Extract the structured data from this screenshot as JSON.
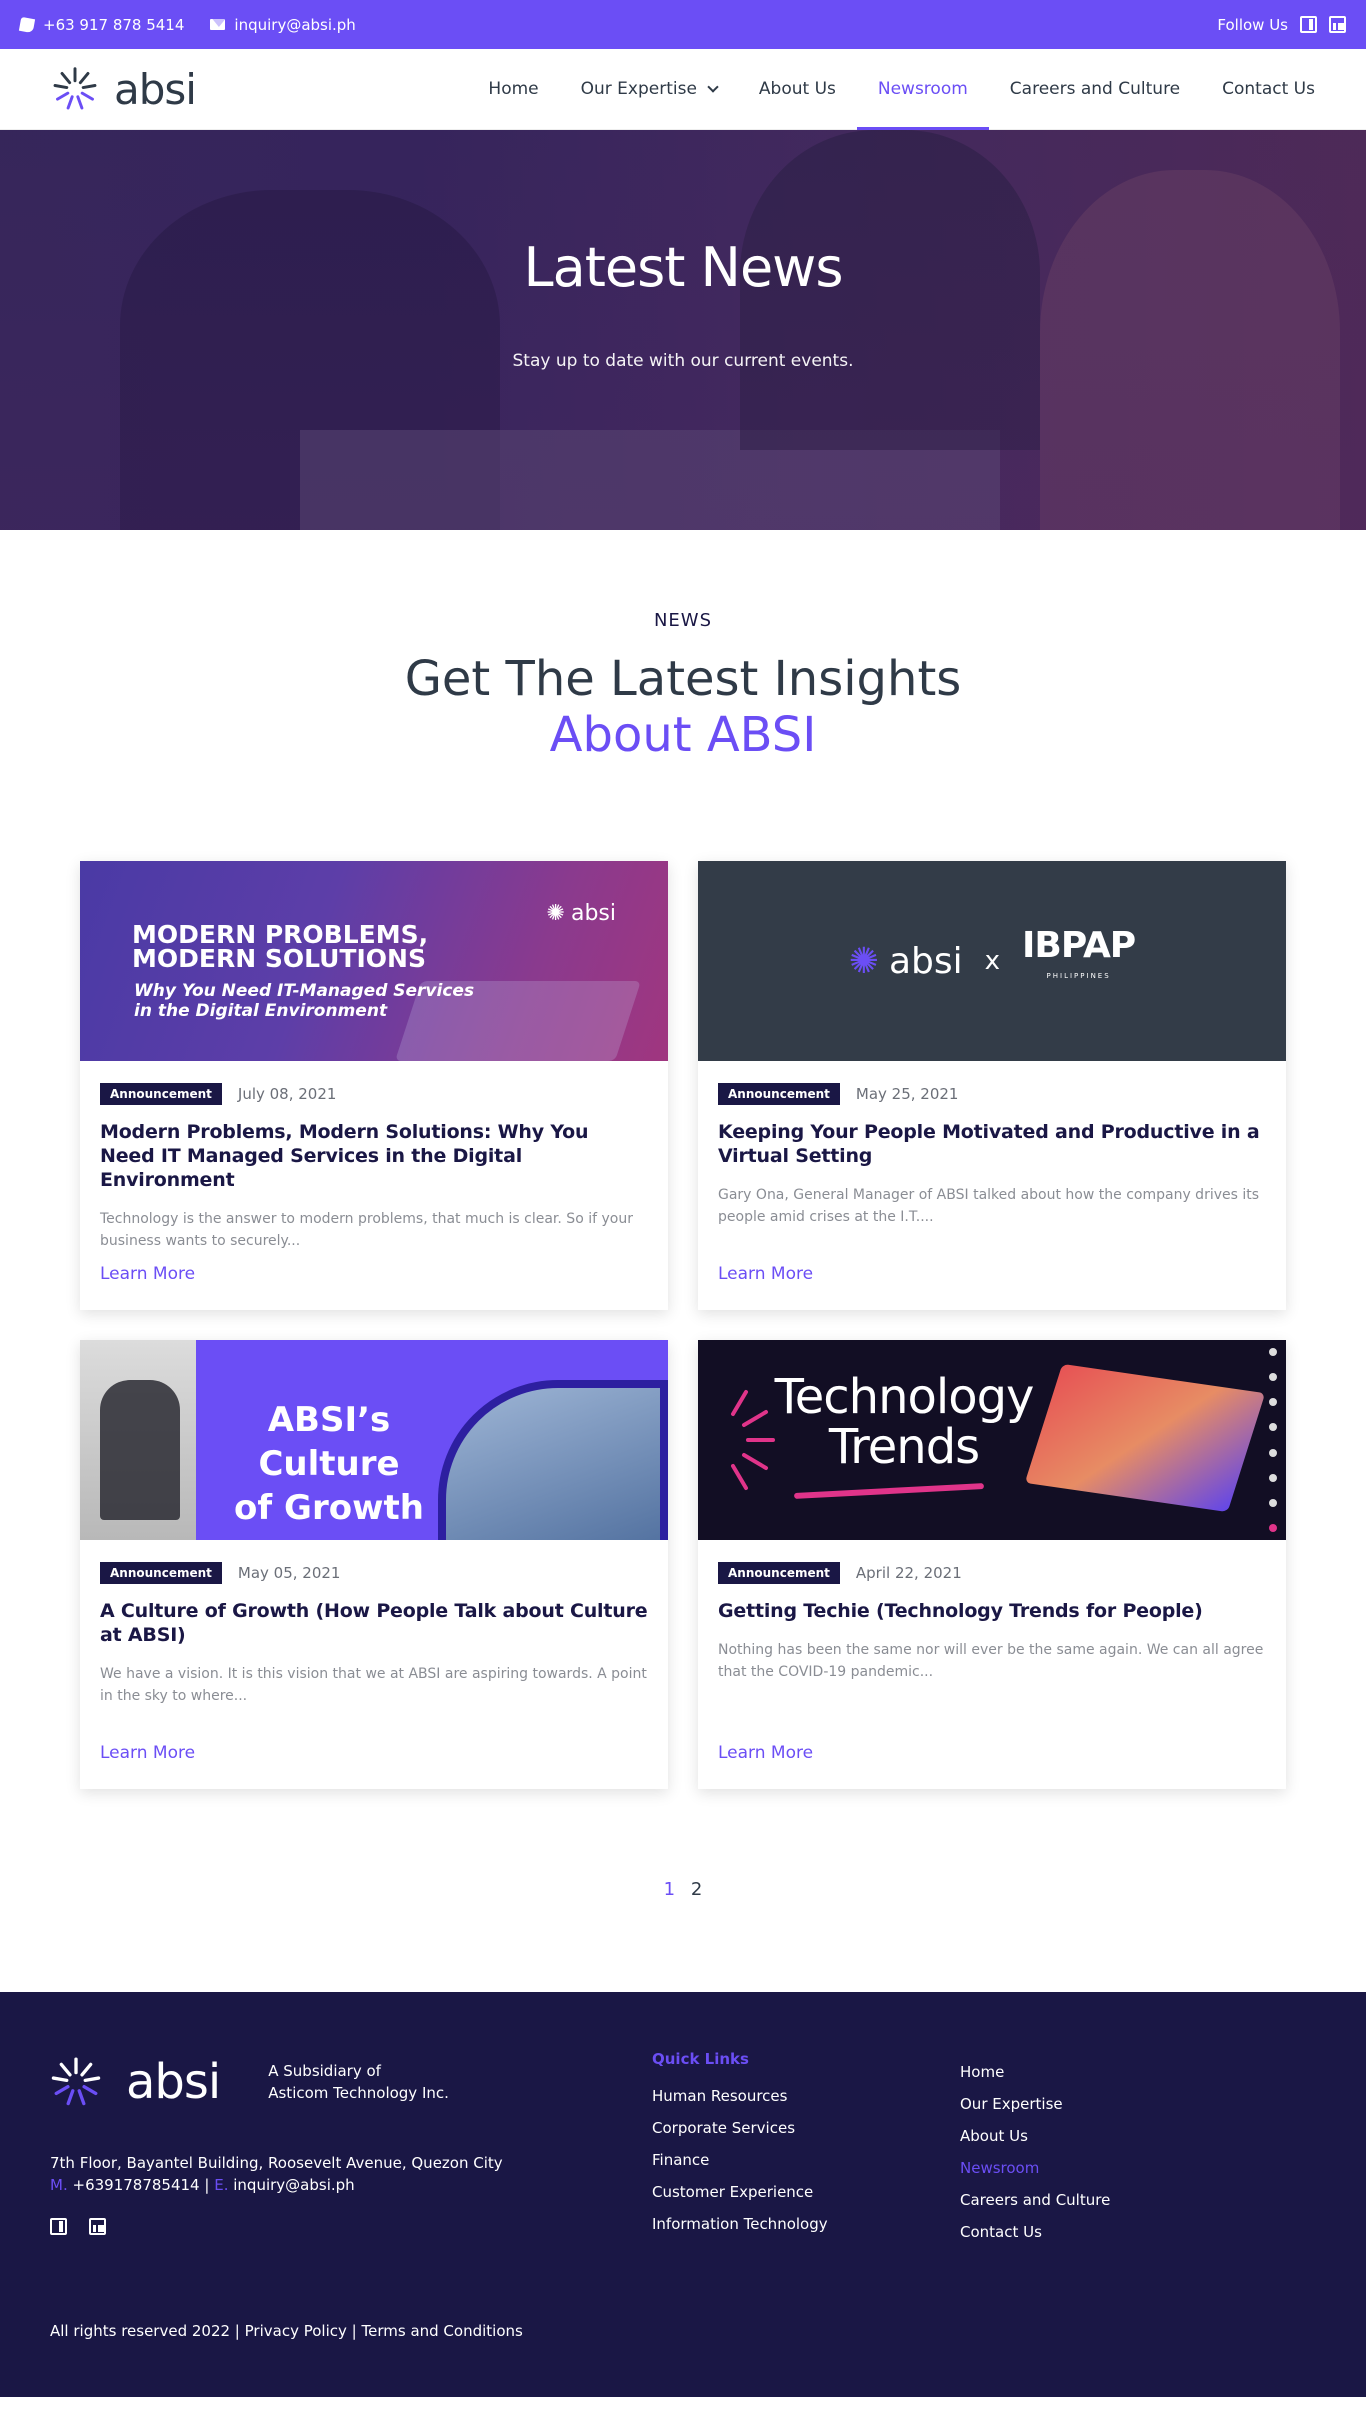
{
  "topbar": {
    "phone": "+63 917 878 5414",
    "email": "inquiry@absi.ph",
    "follow_label": "Follow Us"
  },
  "brand": {
    "name": "absi",
    "accent": "#6b4ef5",
    "dark": "#1a1745"
  },
  "nav": {
    "items": [
      {
        "label": "Home"
      },
      {
        "label": "Our Expertise"
      },
      {
        "label": "About Us"
      },
      {
        "label": "Newsroom"
      },
      {
        "label": "Careers and Culture"
      },
      {
        "label": "Contact Us"
      }
    ],
    "active": "Newsroom"
  },
  "hero": {
    "title": "Latest News",
    "subtitle": "Stay up to date with our current events."
  },
  "section": {
    "eyebrow": "NEWS",
    "title_line1": "Get The Latest Insights",
    "title_line2": "About ABSI"
  },
  "cards": [
    {
      "badge": "Announcement",
      "date": "July 08, 2021",
      "title": "Modern Problems, Modern Solutions: Why You Need IT Managed Services in the Digital Environment",
      "excerpt": "Technology is the answer to modern problems, that much is clear. So if your business wants to securely...",
      "cta": "Learn More",
      "thumb": {
        "line1a": "MODERN PROBLEMS,",
        "line1b": "MODERN SOLUTIONS",
        "line2a": "Why You Need IT-Managed Services",
        "line2b": "in the Digital Environment",
        "brand": "absi"
      }
    },
    {
      "badge": "Announcement",
      "date": "May 25, 2021",
      "title": "Keeping Your People Motivated and Productive in a Virtual Setting",
      "excerpt": "Gary Ona, General Manager of ABSI talked about how the company drives its people amid crises at the I.T....",
      "cta": "Learn More",
      "thumb": {
        "brand": "absi",
        "x": "x",
        "partner": "IBPAP",
        "partner_sub": "PHILIPPINES"
      }
    },
    {
      "badge": "Announcement",
      "date": "May 05, 2021",
      "title": "A Culture of Growth (How People Talk about Culture at ABSI)",
      "excerpt": "We have a vision. It is this vision that we at ABSI are aspiring towards. A point in the sky to where...",
      "cta": "Learn More",
      "thumb": {
        "title_a": "ABSI’s Culture",
        "title_b": "of Growth"
      }
    },
    {
      "badge": "Announcement",
      "date": "April 22, 2021",
      "title": "Getting Techie (Technology Trends for People)",
      "excerpt": "Nothing has been the same nor will ever be the same again. We can all agree that the COVID-19 pandemic...",
      "cta": "Learn More",
      "thumb": {
        "title_a": "Technology",
        "title_b": "Trends"
      }
    }
  ],
  "pagination": {
    "current": "1",
    "next": "2"
  },
  "footer": {
    "brand": "absi",
    "subsidiary_line1": "A Subsidiary of",
    "subsidiary_line2": "Asticom Technology Inc.",
    "address": "7th Floor, Bayantel Building, Roosevelt Avenue, Quezon City",
    "mobile_key": "M.",
    "mobile": "+639178785414",
    "sep": "|",
    "email_key": "E.",
    "email": "inquiry@absi.ph",
    "quick_links_heading": "Quick Links",
    "quick_links": [
      "Human Resources",
      "Corporate Services",
      "Finance",
      "Customer Experience",
      "Information Technology"
    ],
    "site_links": [
      "Home",
      "Our Expertise",
      "About Us",
      "Newsroom",
      "Careers and Culture",
      "Contact Us"
    ],
    "copyright": "All rights reserved 2022 |",
    "privacy": "Privacy Policy",
    "terms": "Terms and Conditions"
  }
}
